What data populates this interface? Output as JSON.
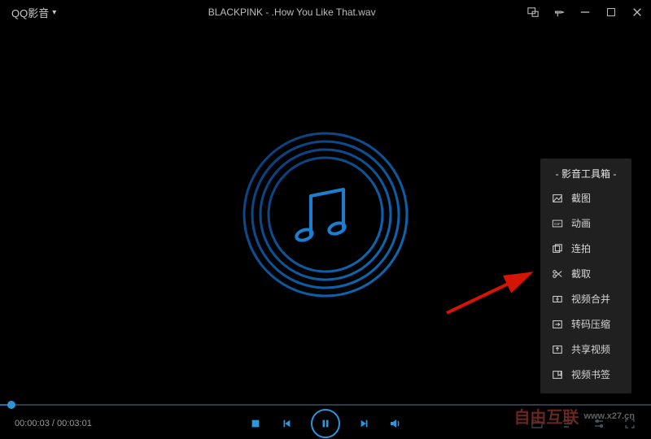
{
  "titlebar": {
    "app_name": "QQ影音",
    "file_name": "BLACKPINK - .How You Like That.wav"
  },
  "toolbox": {
    "title": "- 影音工具箱 -",
    "items": [
      {
        "icon": "screenshot-icon",
        "label": "截图"
      },
      {
        "icon": "gif-icon",
        "label": "动画"
      },
      {
        "icon": "burst-icon",
        "label": "连拍"
      },
      {
        "icon": "scissors-icon",
        "label": "截取"
      },
      {
        "icon": "merge-icon",
        "label": "视频合并"
      },
      {
        "icon": "transcode-icon",
        "label": "转码压缩"
      },
      {
        "icon": "share-icon",
        "label": "共享视频"
      },
      {
        "icon": "bookmark-icon",
        "label": "视频书签"
      }
    ]
  },
  "playback": {
    "elapsed": "00:00:03",
    "duration": "00:03:01",
    "progress_percent": 1.8
  },
  "colors": {
    "accent": "#2a97df",
    "panel": "#202020"
  },
  "watermark": {
    "text": "自由互联",
    "url": "www.x27.cn"
  }
}
